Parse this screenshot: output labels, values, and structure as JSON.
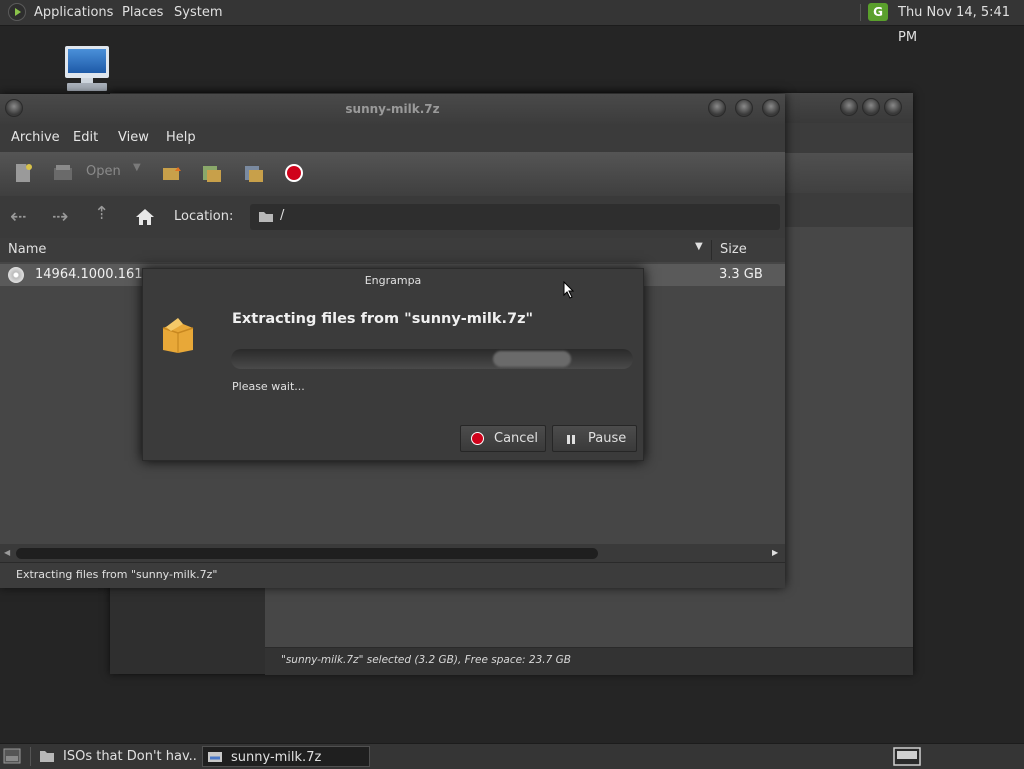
{
  "top_panel": {
    "menu": [
      "Applications",
      "Places",
      "System"
    ],
    "clock": "Thu Nov 14,  5:41 PM",
    "updater_badge": "G"
  },
  "back_window": {
    "status": "\"sunny-milk.7z\" selected (3.2 GB), Free space: 23.7 GB"
  },
  "main_window": {
    "title": "sunny-milk.7z",
    "menu": [
      "Archive",
      "Edit",
      "View",
      "Help"
    ],
    "toolbar": {
      "open_label": "Open"
    },
    "location": {
      "label": "Location:",
      "path": "/"
    },
    "columns": {
      "name": "Name",
      "size": "Size"
    },
    "files": [
      {
        "name": "14964.1000.16110",
        "size": "3.3 GB"
      }
    ],
    "status": "Extracting files from \"sunny-milk.7z\""
  },
  "dialog": {
    "title": "Engrampa",
    "heading": "Extracting files from \"sunny-milk.7z\"",
    "message": "Please wait...",
    "cancel_label": "Cancel",
    "pause_label": "Pause"
  },
  "taskbar": {
    "tasks": [
      "ISOs that Don't hav...",
      "sunny-milk.7z"
    ]
  },
  "colors": {
    "accent_green": "#5aa02c",
    "stop_red": "#d0021b"
  }
}
